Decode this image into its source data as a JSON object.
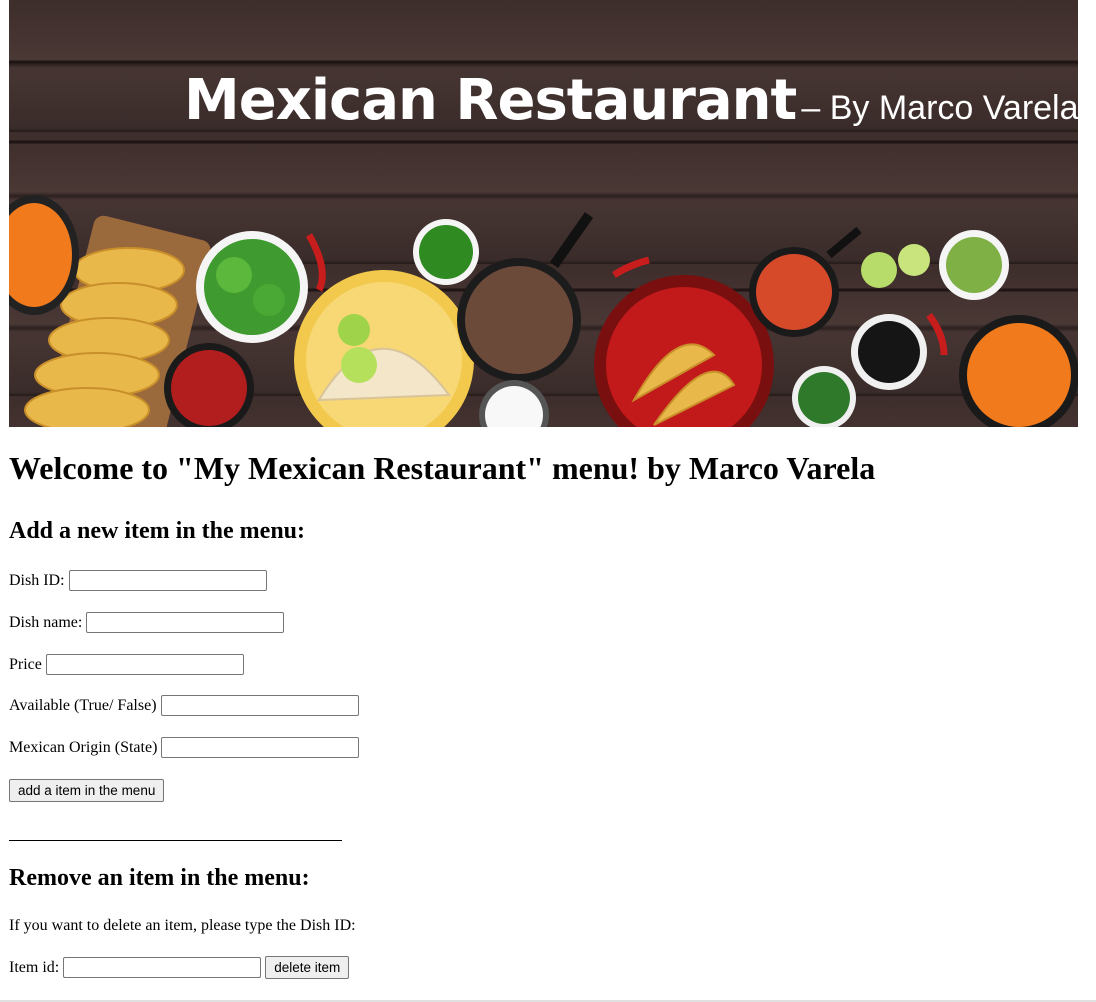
{
  "banner": {
    "title": "Mexican Restaurant",
    "subtitle": "– By Marco Varela"
  },
  "page": {
    "heading": "Welcome to \"My Mexican Restaurant\" menu! by Marco Varela"
  },
  "add_section": {
    "heading": "Add a new item in the menu:",
    "fields": [
      {
        "label": "Dish ID:",
        "value": ""
      },
      {
        "label": "Dish name:",
        "value": ""
      },
      {
        "label": "Price",
        "value": ""
      },
      {
        "label": "Available (True/ False)",
        "value": ""
      },
      {
        "label": "Mexican Origin (State)",
        "value": ""
      }
    ],
    "button_label": "add a item in the menu"
  },
  "remove_section": {
    "heading": "Remove an item in the menu:",
    "instructions": "If you want to delete an item, please type the Dish ID:",
    "field_label": "Item id:",
    "field_value": "",
    "button_label": "delete item"
  }
}
